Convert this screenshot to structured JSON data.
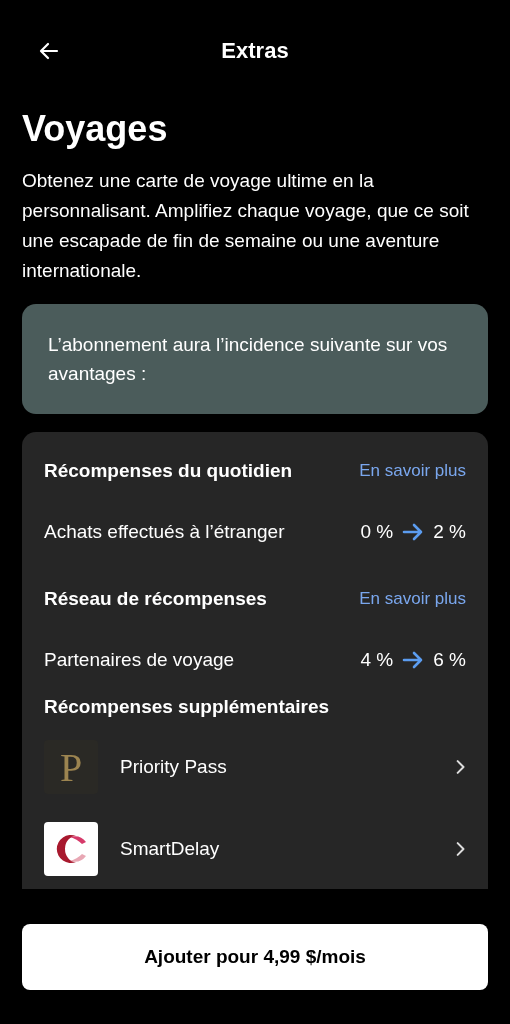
{
  "header": {
    "title": "Extras"
  },
  "page": {
    "title": "Voyages",
    "description": "Obtenez une carte de voyage ultime en la personnalisant. Amplifiez chaque voyage, que ce soit une escapade de fin de semaine ou une aventure internationale."
  },
  "notice": {
    "text": "L’abonnement aura l’incidence suivante sur vos avantages :"
  },
  "sections": [
    {
      "title": "Récompenses du quotidien",
      "link": "En savoir plus",
      "rows": [
        {
          "label": "Achats effectués à l’étranger",
          "from": "0 %",
          "to": "2 %"
        }
      ]
    },
    {
      "title": "Réseau de récompenses",
      "link": "En savoir plus",
      "rows": [
        {
          "label": "Partenaires de voyage",
          "from": "4 %",
          "to": "6 %"
        }
      ]
    }
  ],
  "extras": {
    "title": "Récompenses supplémentaires",
    "items": [
      {
        "kind": "letter",
        "logo_text": "P",
        "name": "Priority Pass"
      },
      {
        "kind": "crescent",
        "name": "SmartDelay"
      }
    ]
  },
  "button": {
    "label": "Ajouter pour 4,99 $/mois"
  }
}
